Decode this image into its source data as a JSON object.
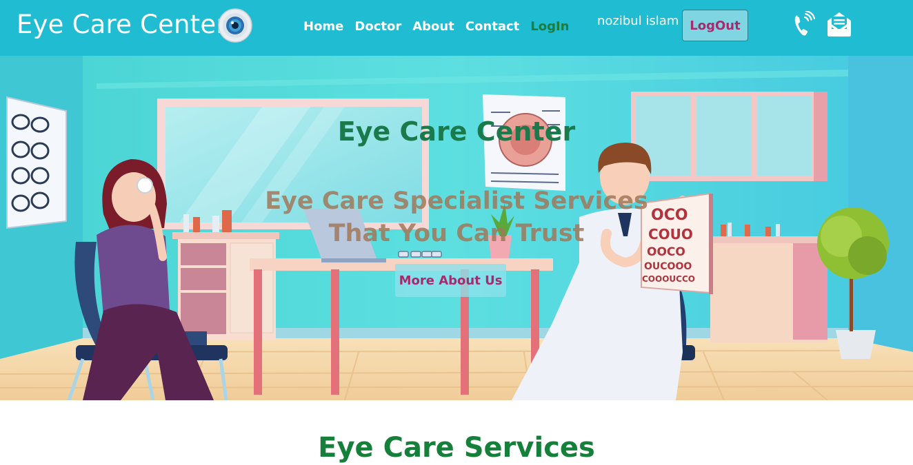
{
  "header": {
    "brand": "Eye Care Center",
    "nav": [
      "Home",
      "Doctor",
      "About",
      "Contact",
      "LogIn"
    ],
    "username": "nozibul islam",
    "logout_label": "LogOut"
  },
  "hero": {
    "title": "Eye Care Center",
    "subtitle": "Eye Care Specialist Services That You Can Trust",
    "button_label": "More About Us",
    "eye_chart_rows": [
      "OCO",
      "COUO",
      "OOCO",
      "OUCOOO",
      "COOOUCCO"
    ]
  },
  "section": {
    "heading": "Eye Care Services"
  },
  "colors": {
    "navbar": "#1fbcd2",
    "login_link": "#1b7d3e",
    "logout_text": "#a52a6e",
    "hero_title": "#1b7a4b"
  },
  "icons": [
    "eye-logo-icon",
    "phone-icon",
    "mail-icon"
  ]
}
